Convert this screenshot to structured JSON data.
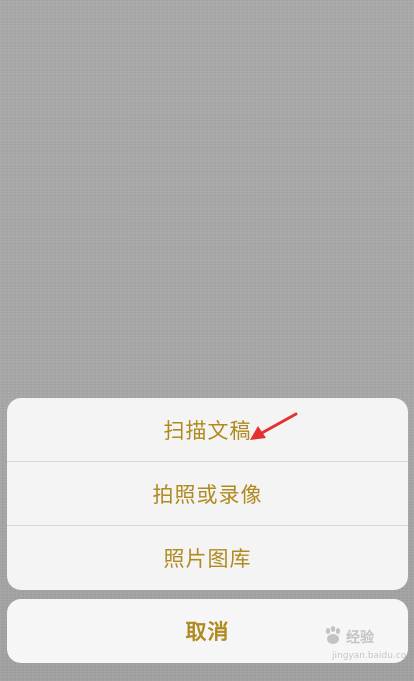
{
  "action_sheet": {
    "items": [
      {
        "label": "扫描文稿"
      },
      {
        "label": "拍照或录像"
      },
      {
        "label": "照片图库"
      }
    ],
    "cancel_label": "取消",
    "accent_color": "#b08a1e"
  },
  "annotation": {
    "arrow_icon": "red-arrow-icon",
    "arrow_color": "#e53030"
  },
  "watermark": {
    "brand_text": "经验",
    "url_text": "jingyan.baidu.com"
  }
}
